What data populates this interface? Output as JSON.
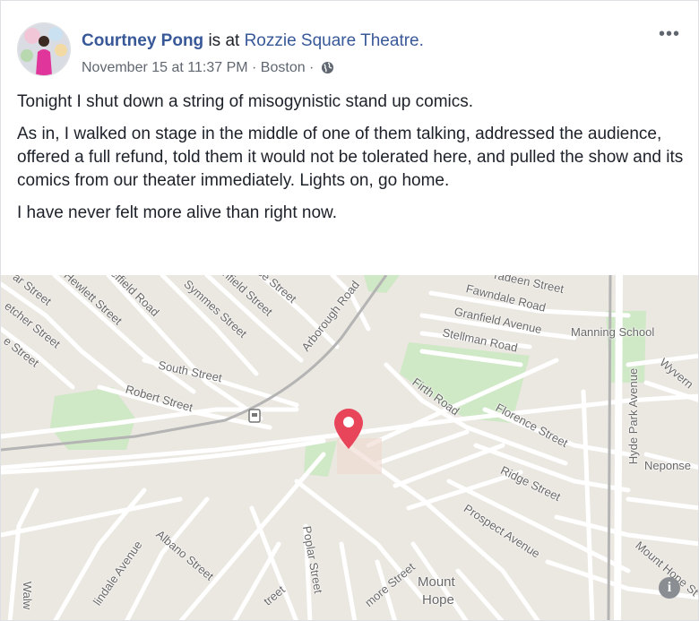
{
  "post": {
    "author": "Courtney Pong",
    "checkin_prefix": " is at ",
    "location": "Rozzie Square Theatre.",
    "timestamp": "November 15 at 11:37 PM",
    "sep1": " · ",
    "city": "Boston",
    "sep2": " · ",
    "privacy_icon": "globe-icon",
    "more_icon": "more-options-icon",
    "paragraphs": [
      "Tonight I shut down a string of misogynistic stand up comics.",
      "As in, I walked on stage in the middle of one of them talking, addressed the audience, offered a full refund, told them it would not be tolerated here, and pulled the show and its comics from our theater immediately. Lights on, go home.",
      "I have never felt more alive than right now."
    ]
  },
  "map": {
    "pin_color": "#e8445a",
    "labels": {
      "ar_street": "ar Street",
      "hewlett": "Hewlett Street",
      "effield": "effield Road",
      "symmes": "Symmes Street",
      "shfield": "shfield Street",
      "se_street": "se Street",
      "arborough": "Arborough Road",
      "radeen": "radeen Street",
      "fawndale": "Fawndale Road",
      "granfield": "Granfield Avenue",
      "stellman": "Stellman Road",
      "manning": "Manning School",
      "wyvern": "Wyvern",
      "etcher": "etcher Street",
      "e_street": "e Street",
      "south": "South Street",
      "robert": "Robert Street",
      "firth": "Firth Road",
      "florence": "Florence Street",
      "hyde_park": "Hyde Park Avenue",
      "neponset": "Neponse",
      "ridge": "Ridge Street",
      "prospect": "Prospect Avenue",
      "albano": "Albano Street",
      "poplar": "Poplar Street",
      "lindale": "lindale Avenue",
      "walw": "Walw",
      "more_street": "more Street",
      "treet": "treet",
      "mount": "Mount",
      "hope": "Hope",
      "mount_hope_st": "Mount Hope St"
    },
    "info_label": "i"
  }
}
